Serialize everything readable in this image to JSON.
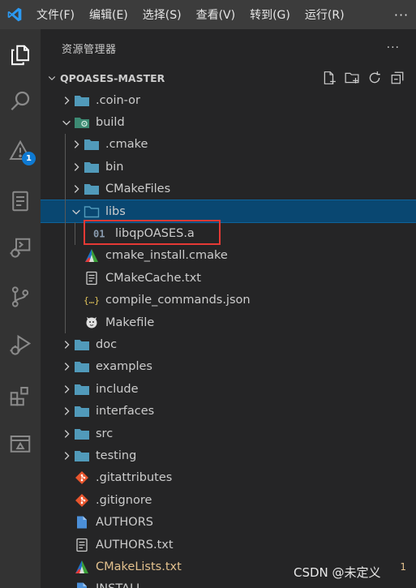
{
  "menu": {
    "items": [
      "文件(F)",
      "编辑(E)",
      "选择(S)",
      "查看(V)",
      "转到(G)",
      "运行(R)"
    ],
    "more": "···"
  },
  "activity_bar": {
    "items": [
      "explorer-icon",
      "search-icon",
      "problems-icon",
      "notebook-icon",
      "debug-console-icon",
      "source-control-icon",
      "run-debug-icon",
      "extensions-icon",
      "remote-explorer-icon"
    ],
    "problems_badge": "1"
  },
  "sidebar": {
    "title": "资源管理器",
    "more": "···",
    "workspace": "QPOASES-MASTER",
    "actions": [
      "new-file-icon",
      "new-folder-icon",
      "refresh-icon",
      "collapse-all-icon"
    ]
  },
  "tree": [
    {
      "label": ".coin-or",
      "kind": "folder",
      "depth": 0,
      "expanded": false
    },
    {
      "label": "build",
      "kind": "folder-build",
      "depth": 0,
      "expanded": true
    },
    {
      "label": ".cmake",
      "kind": "folder",
      "depth": 1,
      "expanded": false
    },
    {
      "label": "bin",
      "kind": "folder",
      "depth": 1,
      "expanded": false
    },
    {
      "label": "CMakeFiles",
      "kind": "folder",
      "depth": 1,
      "expanded": false
    },
    {
      "label": "libs",
      "kind": "folder-open",
      "depth": 1,
      "expanded": true,
      "selected": true
    },
    {
      "label": "libqpOASES.a",
      "kind": "binary",
      "depth": 2
    },
    {
      "label": "cmake_install.cmake",
      "kind": "cmake",
      "depth": 1
    },
    {
      "label": "CMakeCache.txt",
      "kind": "text",
      "depth": 1
    },
    {
      "label": "compile_commands.json",
      "kind": "json",
      "depth": 1
    },
    {
      "label": "Makefile",
      "kind": "makefile",
      "depth": 1
    },
    {
      "label": "doc",
      "kind": "folder",
      "depth": 0,
      "expanded": false
    },
    {
      "label": "examples",
      "kind": "folder",
      "depth": 0,
      "expanded": false
    },
    {
      "label": "include",
      "kind": "folder",
      "depth": 0,
      "expanded": false
    },
    {
      "label": "interfaces",
      "kind": "folder",
      "depth": 0,
      "expanded": false
    },
    {
      "label": "src",
      "kind": "folder",
      "depth": 0,
      "expanded": false
    },
    {
      "label": "testing",
      "kind": "folder",
      "depth": 0,
      "expanded": false
    },
    {
      "label": ".gitattributes",
      "kind": "git",
      "depth": 0
    },
    {
      "label": ".gitignore",
      "kind": "git",
      "depth": 0
    },
    {
      "label": "AUTHORS",
      "kind": "file",
      "depth": 0
    },
    {
      "label": "AUTHORS.txt",
      "kind": "text",
      "depth": 0
    },
    {
      "label": "CMakeLists.txt",
      "kind": "cmake",
      "depth": 0,
      "modified": true,
      "decoration": "1"
    },
    {
      "label": "INSTALL",
      "kind": "file",
      "depth": 0
    }
  ],
  "colors": {
    "folder": "#519aba",
    "selection": "#094771",
    "modified": "#e2c08d",
    "highlight_box": "#e53935",
    "badge": "#0e7ad3"
  },
  "watermark": "CSDN @未定义"
}
